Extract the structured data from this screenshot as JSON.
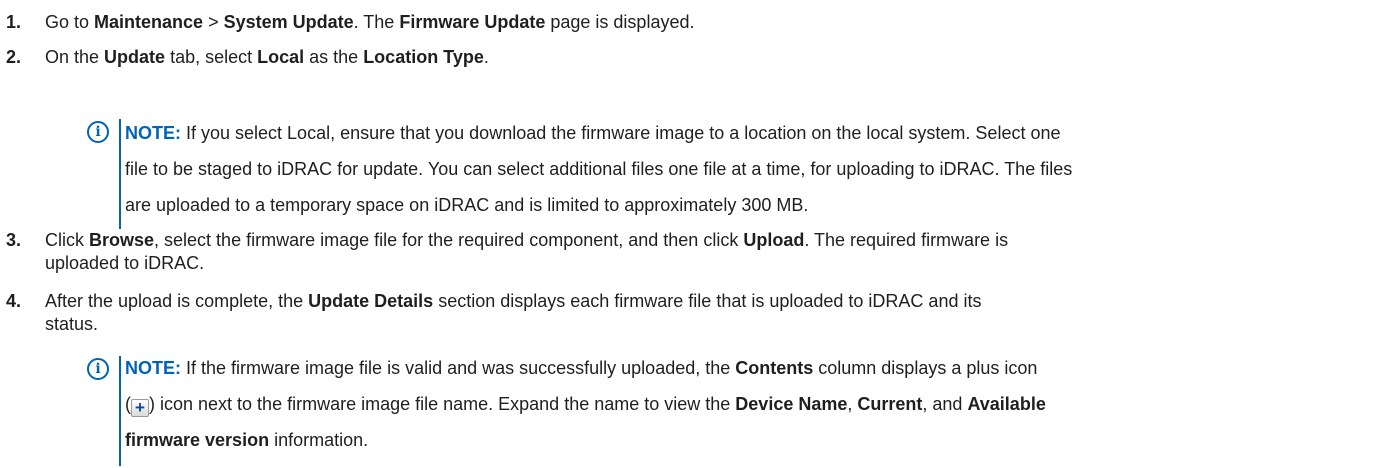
{
  "steps": [
    {
      "num": "1.",
      "t1": "Go to ",
      "b1": "Maintenance",
      "t2": " > ",
      "b2": "System Update",
      "t3": ". The ",
      "b3": "Firmware Update",
      "t4": " page is displayed."
    },
    {
      "num": "2.",
      "t1": "On the ",
      "b1": "Update",
      "t2": " tab, select ",
      "b2": "Local",
      "t3": " as the ",
      "b3": "Location Type",
      "t4": "."
    },
    {
      "num": "3.",
      "t1": "Click ",
      "b1": "Browse",
      "t2": ", select the firmware image file for the required component, and then click ",
      "b2": "Upload",
      "t3": ". The required firmware is",
      "t4": "uploaded to iDRAC."
    },
    {
      "num": "4.",
      "t1": "After the upload is complete, the ",
      "b1": "Update Details",
      "t2": " section displays each firmware file that is uploaded to iDRAC and its",
      "t3": "status."
    }
  ],
  "notes": [
    {
      "icon": "i",
      "head": "NOTE:",
      "l1": " If you select Local, ensure that you download the firmware image to a location on the local system. Select one",
      "l2": "file to be staged to iDRAC for update. You can select additional files one file at a time, for uploading to iDRAC. The files",
      "l3": "are uploaded to a temporary space on iDRAC and is limited to approximately 300 MB."
    },
    {
      "icon": "i",
      "head": "NOTE:",
      "l1a": " If the firmware image file is valid and was successfully uploaded, the ",
      "l1b": "Contents",
      "l1c": " column displays a plus icon",
      "l2a": "(",
      "plus": "+",
      "l2b": ") icon next to the firmware image file name. Expand the name to view the ",
      "l2c": "Device Name",
      "l2d": ", ",
      "l2e": "Current",
      "l2f": ", and ",
      "l2g": "Available",
      "l3a": "firmware version",
      "l3b": " information."
    }
  ]
}
